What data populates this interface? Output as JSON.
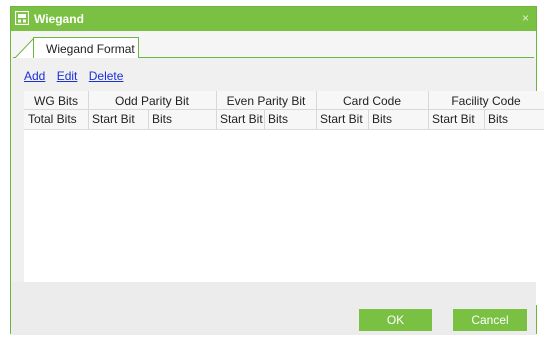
{
  "window": {
    "title": "Wiegand",
    "close_glyph": "×",
    "accent": "#7ac143",
    "icon": "wiegand-app-icon"
  },
  "tabs": [
    {
      "label": "Wiegand Format",
      "active": true
    }
  ],
  "actions": {
    "add": "Add",
    "edit": "Edit",
    "delete": "Delete"
  },
  "table": {
    "group_headers": [
      "WG Bits",
      "Odd Parity Bit",
      "Even Parity Bit",
      "Card Code",
      "Facility Code"
    ],
    "sub_headers": [
      "Total Bits",
      "Start Bit",
      "Bits",
      "Start Bit",
      "Bits",
      "Start Bit",
      "Bits",
      "Start Bit",
      "Bits"
    ],
    "rows": []
  },
  "buttons": {
    "ok": "OK",
    "cancel": "Cancel"
  }
}
